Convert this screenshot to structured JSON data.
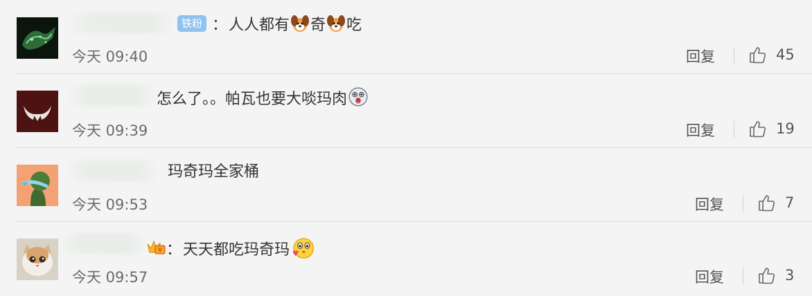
{
  "comments": [
    {
      "badge": "铁粉",
      "colon": "：",
      "text_parts": [
        "人人都有",
        "奇",
        "吃"
      ],
      "time": "今天 09:40",
      "reply_label": "回复",
      "likes": "45"
    },
    {
      "text": "怎么了。。帕瓦也要大啖玛肉",
      "time": "今天 09:39",
      "reply_label": "回复",
      "likes": "19"
    },
    {
      "text": "玛奇玛全家桶",
      "time": "今天 09:53",
      "reply_label": "回复",
      "likes": "7"
    },
    {
      "colon": "：",
      "text": "天天都吃玛奇玛",
      "time": "今天 09:57",
      "reply_label": "回复",
      "likes": "3"
    }
  ],
  "colors": {
    "background": "#f4f4f4",
    "badge": "#8fc2ef",
    "text": "#333333",
    "meta": "#6b6b6b"
  },
  "icons": [
    "dog-emoji-icon",
    "shocked-face-emoji-icon",
    "kiss-face-emoji-icon",
    "vip-crown-icon",
    "thumbs-up-icon"
  ]
}
